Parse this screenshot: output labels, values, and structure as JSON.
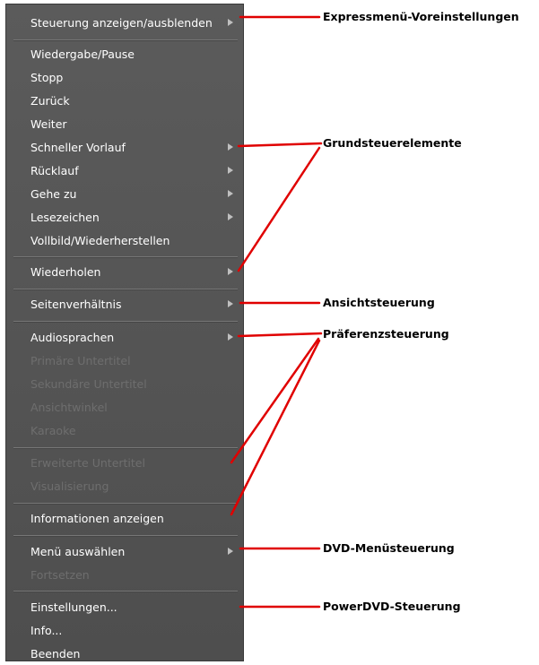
{
  "menu": {
    "items": [
      {
        "label": "Steuerung anzeigen/ausblenden",
        "enabled": true,
        "submenu": true
      },
      {
        "label": "Wiedergabe/Pause",
        "enabled": true,
        "submenu": false
      },
      {
        "label": "Stopp",
        "enabled": true,
        "submenu": false
      },
      {
        "label": "Zurück",
        "enabled": true,
        "submenu": false
      },
      {
        "label": "Weiter",
        "enabled": true,
        "submenu": false
      },
      {
        "label": "Schneller Vorlauf",
        "enabled": true,
        "submenu": true
      },
      {
        "label": "Rücklauf",
        "enabled": true,
        "submenu": true
      },
      {
        "label": "Gehe zu",
        "enabled": true,
        "submenu": true
      },
      {
        "label": "Lesezeichen",
        "enabled": true,
        "submenu": true
      },
      {
        "label": "Vollbild/Wiederherstellen",
        "enabled": true,
        "submenu": false
      },
      {
        "label": "Wiederholen",
        "enabled": true,
        "submenu": true
      },
      {
        "label": "Seitenverhältnis",
        "enabled": true,
        "submenu": true
      },
      {
        "label": "Audiosprachen",
        "enabled": true,
        "submenu": true
      },
      {
        "label": "Primäre Untertitel",
        "enabled": false,
        "submenu": false
      },
      {
        "label": "Sekundäre Untertitel",
        "enabled": false,
        "submenu": false
      },
      {
        "label": "Ansichtwinkel",
        "enabled": false,
        "submenu": false
      },
      {
        "label": "Karaoke",
        "enabled": false,
        "submenu": false
      },
      {
        "label": "Erweiterte Untertitel",
        "enabled": false,
        "submenu": false
      },
      {
        "label": "Visualisierung",
        "enabled": false,
        "submenu": false
      },
      {
        "label": "Informationen anzeigen",
        "enabled": true,
        "submenu": false
      },
      {
        "label": "Menü auswählen",
        "enabled": true,
        "submenu": true
      },
      {
        "label": "Fortsetzen",
        "enabled": false,
        "submenu": false
      },
      {
        "label": "Einstellungen...",
        "enabled": true,
        "submenu": false
      },
      {
        "label": "Info...",
        "enabled": true,
        "submenu": false
      },
      {
        "label": "Beenden",
        "enabled": true,
        "submenu": false
      }
    ]
  },
  "callouts": {
    "express": "Expressmenü-Voreinstellungen",
    "basic": "Grundsteuerelemente",
    "view": "Ansichtsteuerung",
    "preference": "Präferenzsteuerung",
    "dvd": "DVD-Menüsteuerung",
    "powerdvd": "PowerDVD-Steuerung"
  },
  "colors": {
    "menu_background": "#555555",
    "enabled_text": "#ffffff",
    "disabled_text": "#6e6e6e",
    "callout_line": "#e00000"
  }
}
